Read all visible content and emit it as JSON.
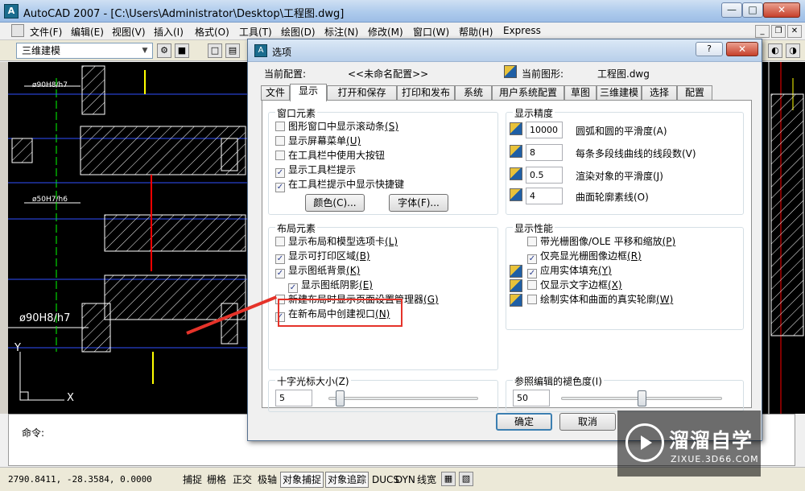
{
  "window": {
    "title": "AutoCAD 2007 - [C:\\Users\\Administrator\\Desktop\\工程图.dwg]",
    "min": "—",
    "max": "□",
    "close": "✕",
    "app_icon": "A"
  },
  "menu": {
    "items": [
      "文件(F)",
      "编辑(E)",
      "视图(V)",
      "插入(I)",
      "格式(O)",
      "工具(T)",
      "绘图(D)",
      "标注(N)",
      "修改(M)",
      "窗口(W)",
      "帮助(H)",
      "Express"
    ]
  },
  "toolbar": {
    "workspace": "三维建模"
  },
  "drawing": {
    "labels": [
      "ø90H8/h7",
      "ø50H7/h6",
      "ø90H8/h7",
      "X",
      "Y"
    ],
    "colors": {
      "hatch": "#ffffff",
      "red": "#ff0000",
      "yellow": "#ffff00",
      "blue": "#3050ff",
      "green": "#00ff00"
    }
  },
  "command": {
    "prompt": "命令:"
  },
  "status": {
    "coords": "2790.8411, -28.3584, 0.0000",
    "buttons": [
      "捕捉",
      "栅格",
      "正交",
      "极轴",
      "对象捕捉",
      "对象追踪",
      "DUCS",
      "DYN",
      "线宽"
    ]
  },
  "dialog": {
    "icon": "A",
    "title": "选项",
    "help": "?",
    "close": "✕",
    "current_profile_label": "当前配置:",
    "current_profile_value": "<<未命名配置>>",
    "current_drawing_label": "当前图形:",
    "current_drawing_value": "工程图.dwg",
    "tabs": [
      "文件",
      "显示",
      "打开和保存",
      "打印和发布",
      "系统",
      "用户系统配置",
      "草图",
      "三维建模",
      "选择",
      "配置"
    ],
    "active_tab": "显示",
    "window_elements": {
      "title": "窗口元素",
      "items": [
        {
          "label": "图形窗口中显示滚动条",
          "key": "(S)",
          "checked": false
        },
        {
          "label": "显示屏幕菜单",
          "key": "(U)",
          "checked": false
        },
        {
          "label": "在工具栏中使用大按钮",
          "key": "",
          "checked": false
        },
        {
          "label": "显示工具栏提示",
          "key": "",
          "checked": true
        },
        {
          "label": "在工具栏提示中显示快捷键",
          "key": "",
          "checked": true
        }
      ],
      "colors_btn": "颜色(C)...",
      "fonts_btn": "字体(F)..."
    },
    "display_resolution": {
      "title": "显示精度",
      "items": [
        {
          "value": "10000",
          "label": "圆弧和圆的平滑度(A)"
        },
        {
          "value": "8",
          "label": "每条多段线曲线的线段数(V)"
        },
        {
          "value": "0.5",
          "label": "渲染对象的平滑度(J)"
        },
        {
          "value": "4",
          "label": "曲面轮廓素线(O)"
        }
      ]
    },
    "layout_elements": {
      "title": "布局元素",
      "items": [
        {
          "label": "显示布局和模型选项卡",
          "key": "(L)",
          "checked": false
        },
        {
          "label": "显示可打印区域",
          "key": "(B)",
          "checked": true
        },
        {
          "label": "显示图纸背景",
          "key": "(K)",
          "checked": true
        },
        {
          "label": "显示图纸阴影",
          "key": "(E)",
          "checked": true
        },
        {
          "label": "新建布局时显示页面设置管理器",
          "key": "(G)",
          "checked": false
        },
        {
          "label": "在新布局中创建视口",
          "key": "(N)",
          "checked": true
        }
      ]
    },
    "display_performance": {
      "title": "显示性能",
      "items": [
        {
          "label": "带光栅图像/OLE 平移和缩放",
          "key": "(P)",
          "checked": false
        },
        {
          "label": "仅亮显光栅图像边框",
          "key": "(R)",
          "checked": true
        },
        {
          "label": "应用实体填充",
          "key": "(Y)",
          "checked": true
        },
        {
          "label": "仅显示文字边框",
          "key": "(X)",
          "checked": false
        },
        {
          "label": "绘制实体和曲面的真实轮廓",
          "key": "(W)",
          "checked": false
        }
      ]
    },
    "crosshair": {
      "title": "十字光标大小(Z)",
      "value": "5",
      "level": 0.05
    },
    "xref_fade": {
      "title": "参照编辑的褪色度(I)",
      "value": "50",
      "level": 0.5
    },
    "ok": "确定",
    "cancel": "取消"
  },
  "watermark": {
    "cn": "溜溜自学",
    "en": "ZIXUE.3D66.COM"
  }
}
